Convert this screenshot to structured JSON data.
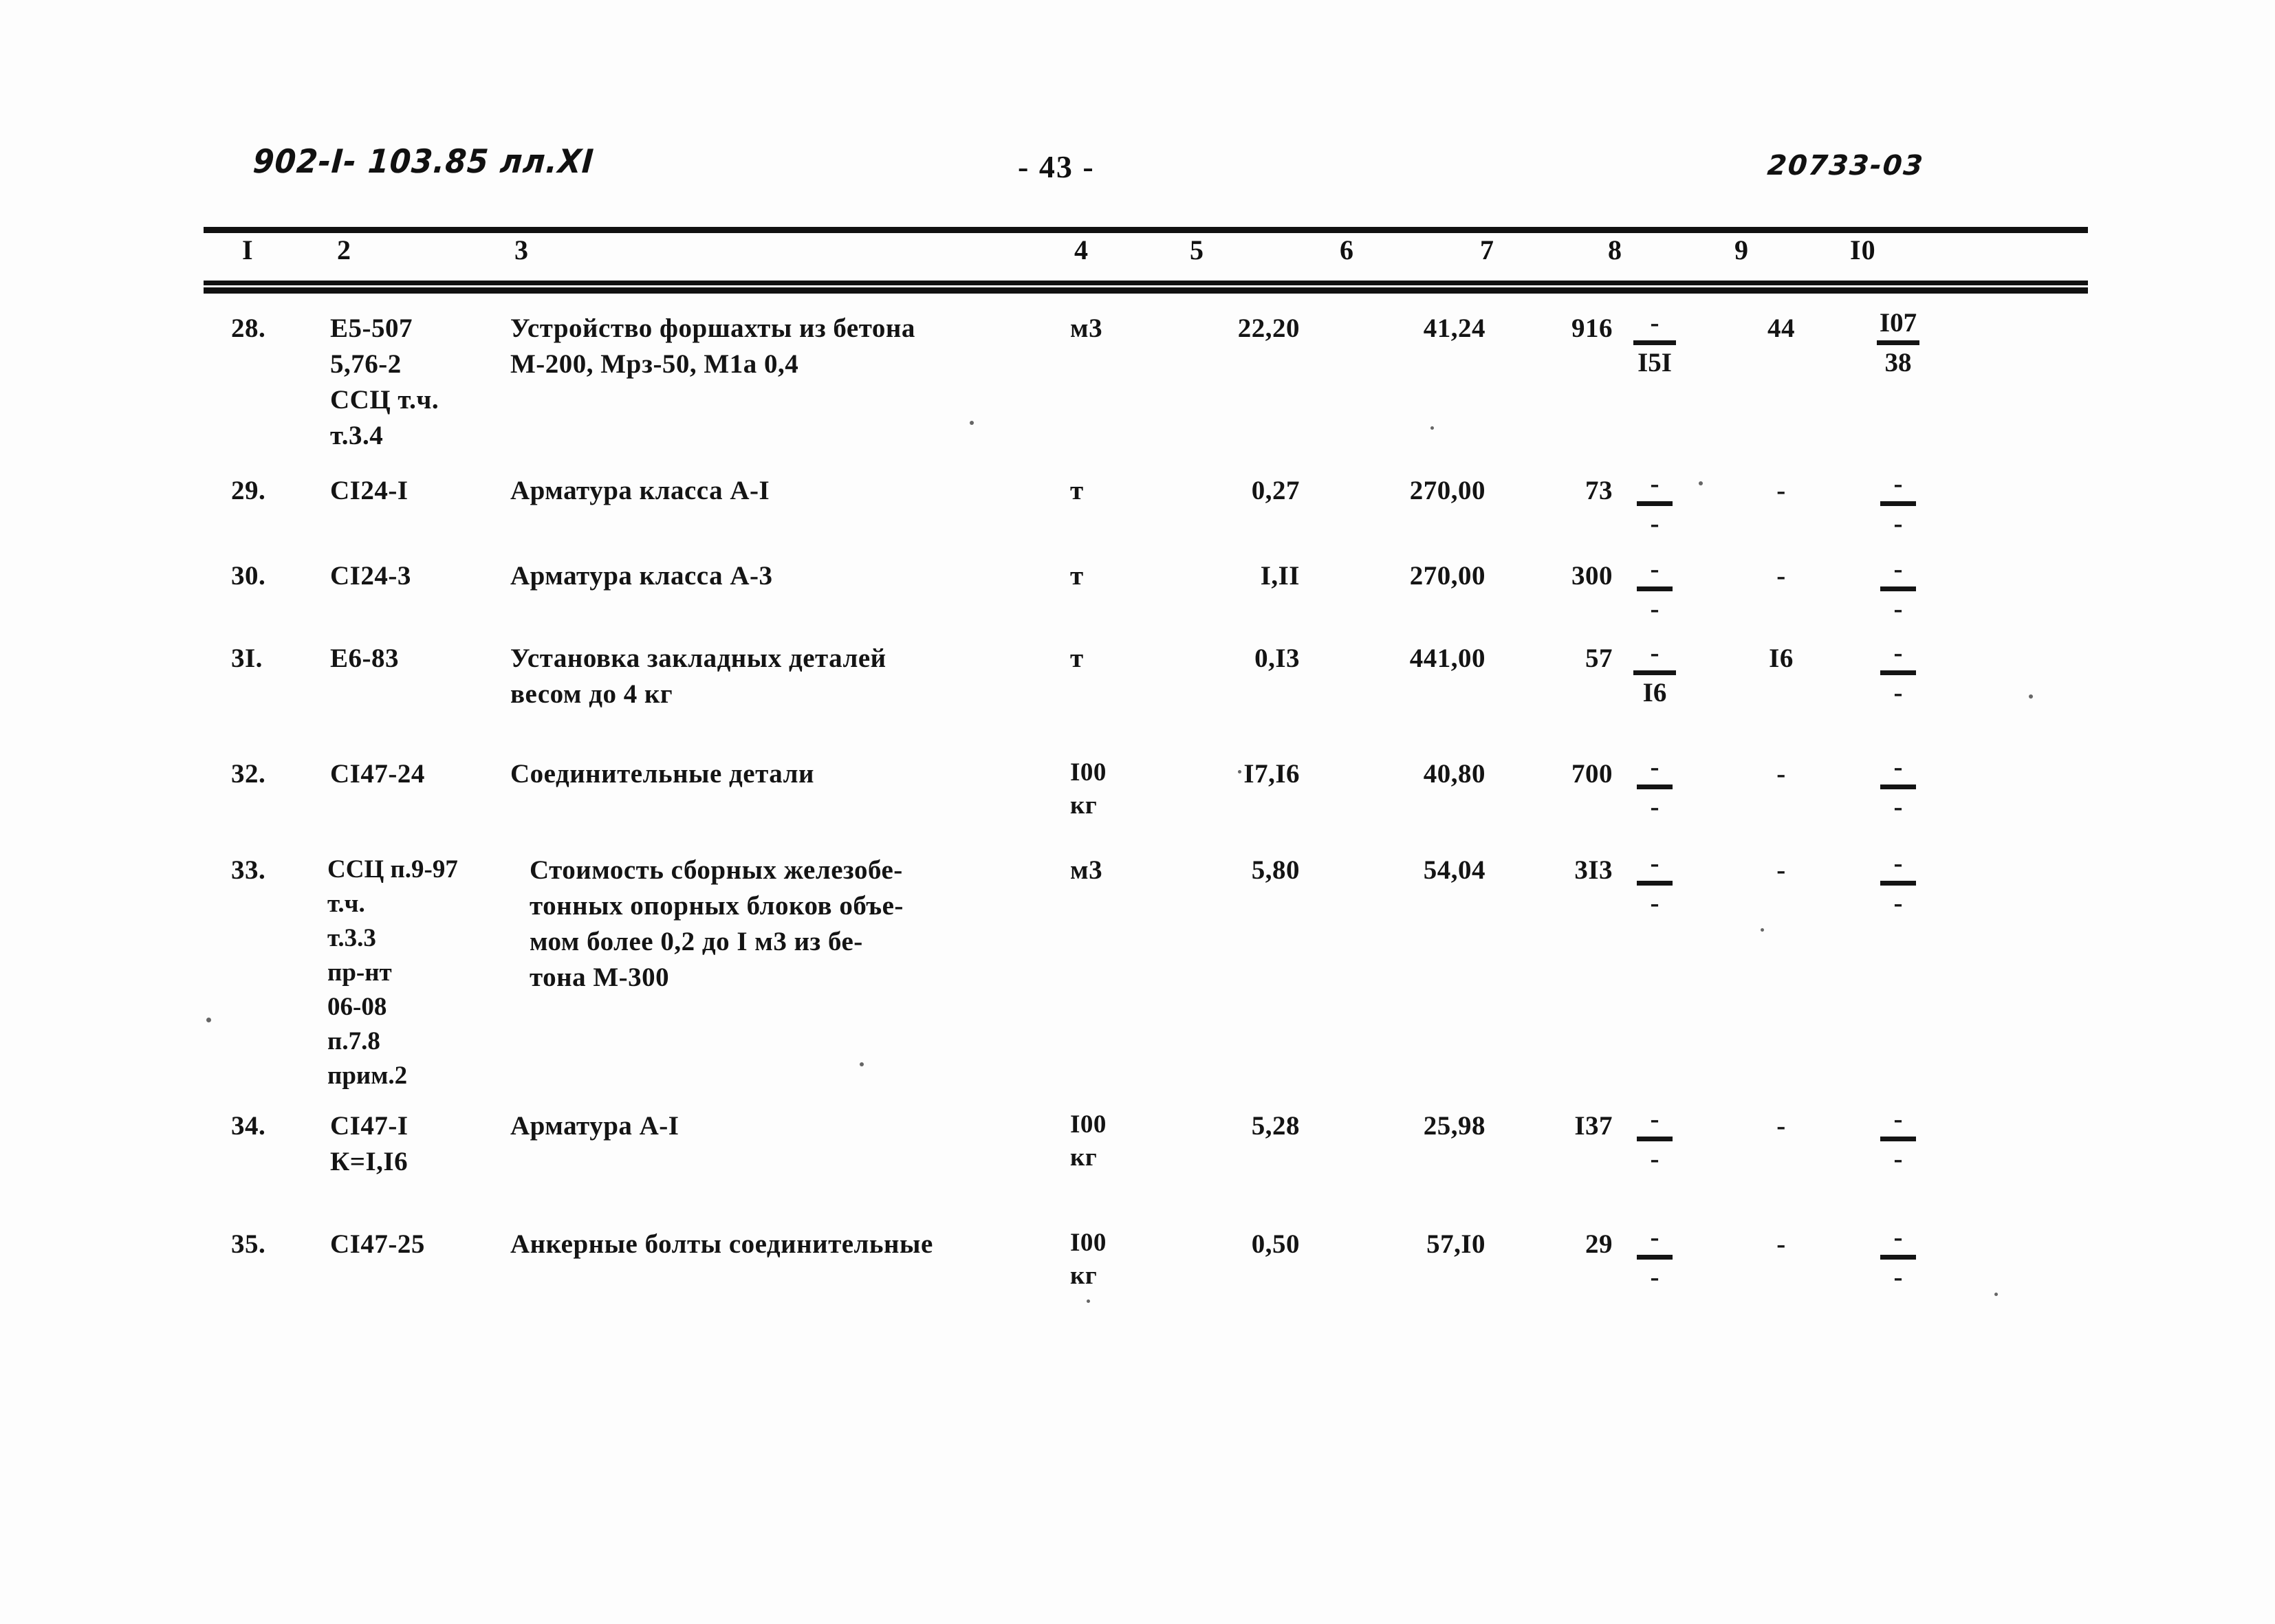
{
  "document": {
    "header_left": "902-I- 103.85 лл.XI",
    "page_label": "- 43 -",
    "header_right": "20733-03"
  },
  "table": {
    "column_headers": [
      "I",
      "2",
      "3",
      "4",
      "5",
      "6",
      "7",
      "8",
      "9",
      "I0"
    ],
    "rows": [
      {
        "num": "28.",
        "code": "Е5-507\n5,76-2\nССЦ т.ч.\nт.3.4",
        "desc": "Устройство форшахты из бетона\nМ-200, Мрз-50, М1а 0,4",
        "unit": "м3",
        "qty": "22,20",
        "price": "41,24",
        "sum": "916",
        "col8_numer": "-",
        "col8_denom": "I5I",
        "col9": "44",
        "col10_numer": "I07",
        "col10_denom": "38"
      },
      {
        "num": "29.",
        "code": "СI24-I",
        "desc": "Арматура класса  А-I",
        "unit": "т",
        "qty": "0,27",
        "price": "270,00",
        "sum": "73",
        "col8_numer": "-",
        "col8_denom": "-",
        "col9": "-",
        "col10_numer": "-",
        "col10_denom": "-"
      },
      {
        "num": "30.",
        "code": "СI24-3",
        "desc": "Арматура класса А-3",
        "unit": "т",
        "qty": "I,II",
        "price": "270,00",
        "sum": "300",
        "col8_numer": "-",
        "col8_denom": "-",
        "col9": "-",
        "col10_numer": "-",
        "col10_denom": "-"
      },
      {
        "num": "3I.",
        "code": "Е6-83",
        "desc": "Установка закладных деталей\nвесом  до 4 кг",
        "unit": "т",
        "qty": "0,I3",
        "price": "441,00",
        "sum": "57",
        "col8_numer": "-",
        "col8_denom": "I6",
        "col9": "I6",
        "col10_numer": "-",
        "col10_denom": "-"
      },
      {
        "num": "32.",
        "code": "СI47-24",
        "desc": "Соединительные детали",
        "unit": "I00\nкг",
        "qty": "I7,I6",
        "price": "40,80",
        "sum": "700",
        "col8_numer": "-",
        "col8_denom": "-",
        "col9": "-",
        "col10_numer": "-",
        "col10_denom": "-"
      },
      {
        "num": "33.",
        "code": "ССЦ п.9-97\nт.ч.\nт.3.3\nпр-нт\n06-08\nп.7.8\nприм.2",
        "desc": "Стоимость сборных железобе-\nтонных опорных блоков объе-\nмом более 0,2 до I м3 из бе-\nтона М-300",
        "unit": "м3",
        "qty": "5,80",
        "price": "54,04",
        "sum": "3I3",
        "col8_numer": "-",
        "col8_denom": "-",
        "col9": "-",
        "col10_numer": "-",
        "col10_denom": "-"
      },
      {
        "num": "34.",
        "code": "СI47-I\nК=I,I6",
        "desc": "Арматура А-I",
        "unit": "I00\nкг",
        "qty": "5,28",
        "price": "25,98",
        "sum": "I37",
        "col8_numer": "-",
        "col8_denom": "-",
        "col9": "-",
        "col10_numer": "-",
        "col10_denom": "-"
      },
      {
        "num": "35.",
        "code": "СI47-25",
        "desc": "Анкерные болты соединительные",
        "unit": "I00\nкг",
        "qty": "0,50",
        "price": "57,I0",
        "sum": "29",
        "col8_numer": "-",
        "col8_denom": "-",
        "col9": "-",
        "col10_numer": "-",
        "col10_denom": "-"
      }
    ]
  }
}
